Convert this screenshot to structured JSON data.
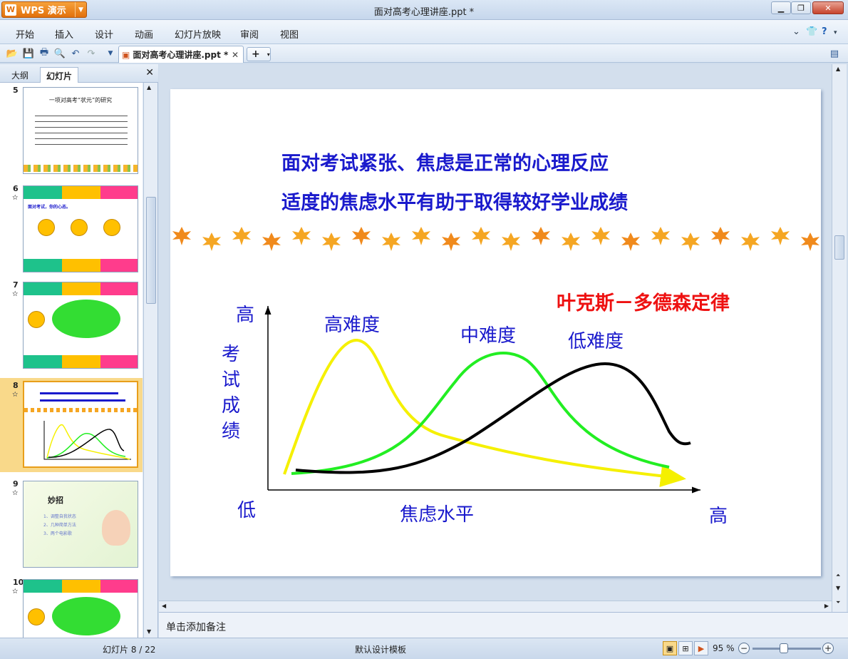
{
  "app": {
    "button_label": "WPS 演示",
    "logo_letter": "W",
    "window_title": "面对高考心理讲座.ppt *"
  },
  "menu": {
    "items": [
      "开始",
      "插入",
      "设计",
      "动画",
      "幻灯片放映",
      "审阅",
      "视图"
    ]
  },
  "toolbar": {
    "doc_tab_label": "面对高考心理讲座.ppt *",
    "new_tab_label": "+"
  },
  "panel": {
    "tabs": [
      "大纲",
      "幻灯片"
    ],
    "active_tab": "幻灯片"
  },
  "thumbnails": [
    {
      "number": "5",
      "title": "一项对高考“状元”的研究",
      "starred": false
    },
    {
      "number": "6",
      "title": "面对考试，你的心态。",
      "starred": true
    },
    {
      "number": "7",
      "title": "",
      "starred": true
    },
    {
      "number": "8",
      "title": "",
      "starred": true,
      "selected": true
    },
    {
      "number": "9",
      "title": "妙招",
      "starred": true,
      "items": [
        "1、调整自我状态",
        "2、几种简单方法",
        "3、两个电影歌"
      ]
    },
    {
      "number": "10",
      "title": "",
      "starred": true
    }
  ],
  "slide": {
    "line1": "面对考试紧张、焦虑是正常的心理反应",
    "line2": "适度的焦虑水平有助于取得较好学业成绩",
    "law_title": "叶克斯－多德森定律",
    "y_axis_high": "高",
    "y_axis_label": "考试成绩",
    "y_axis_low": "低",
    "x_axis_label": "焦虑水平",
    "x_axis_high": "高",
    "series_labels": [
      "高难度",
      "中难度",
      "低难度"
    ],
    "colors": {
      "high": "#f5f000",
      "mid": "#22ee22",
      "low": "#000000",
      "title_blue": "#1a1acc",
      "law_red": "#ee1111"
    }
  },
  "notes": {
    "placeholder": "单击添加备注"
  },
  "status": {
    "slide_counter": "幻灯片 8 / 22",
    "template": "默认设计模板",
    "zoom": "95 %"
  }
}
